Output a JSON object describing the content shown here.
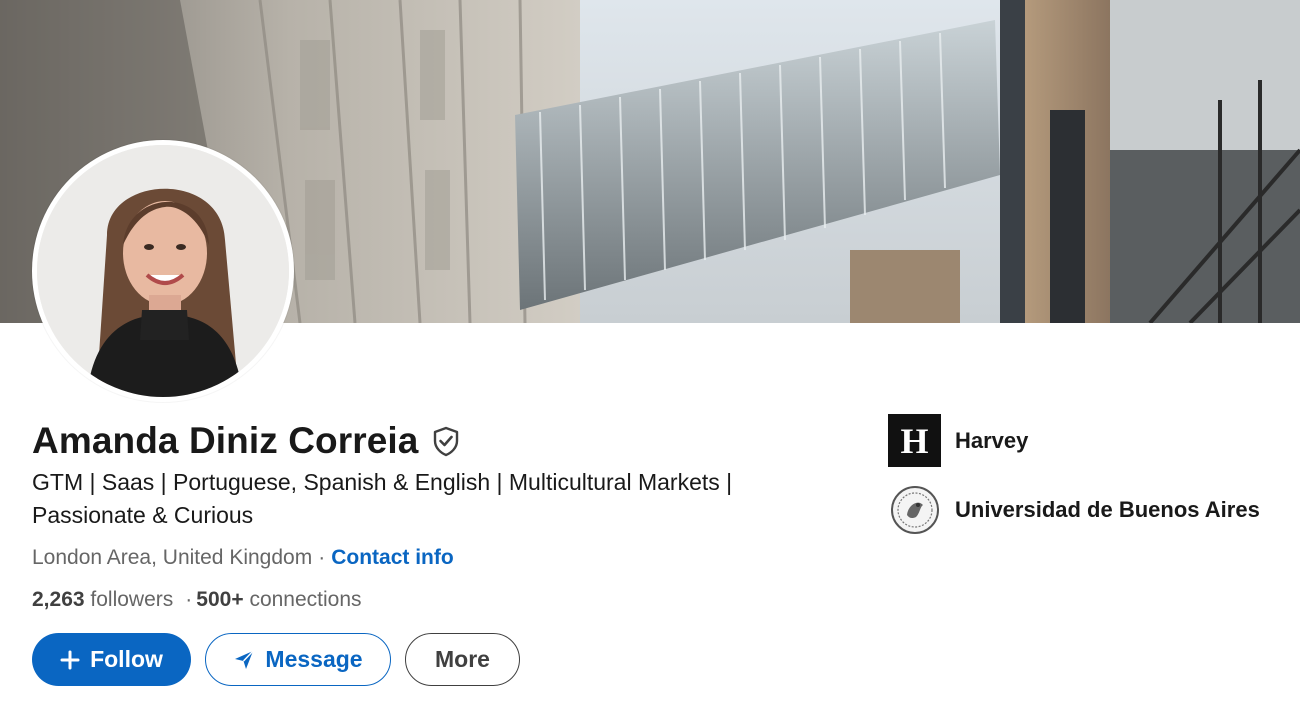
{
  "profile": {
    "name": "Amanda Diniz Correia",
    "headline": "GTM | Saas | Portuguese, Spanish & English | Multicultural Markets | Passionate & Curious",
    "location": "London Area, United Kingdom",
    "location_separator": "·",
    "contact_info_label": "Contact info",
    "followers_count": "2,263",
    "followers_label": "followers",
    "connections_separator": "·",
    "connections_count": "500+",
    "connections_label": "connections",
    "verified_icon": "verified-shield-icon"
  },
  "actions": {
    "follow_label": "Follow",
    "follow_icon": "plus-icon",
    "message_label": "Message",
    "message_icon": "paper-plane-icon",
    "more_label": "More"
  },
  "orgs": [
    {
      "name": "Harvey",
      "logo_text": "H",
      "logo": "harvey-logo"
    },
    {
      "name": "Universidad de Buenos Aires",
      "logo": "uba-seal-logo"
    }
  ],
  "colors": {
    "brand_blue": "#0a66c2",
    "text_primary": "#191919",
    "text_secondary": "#666666"
  }
}
